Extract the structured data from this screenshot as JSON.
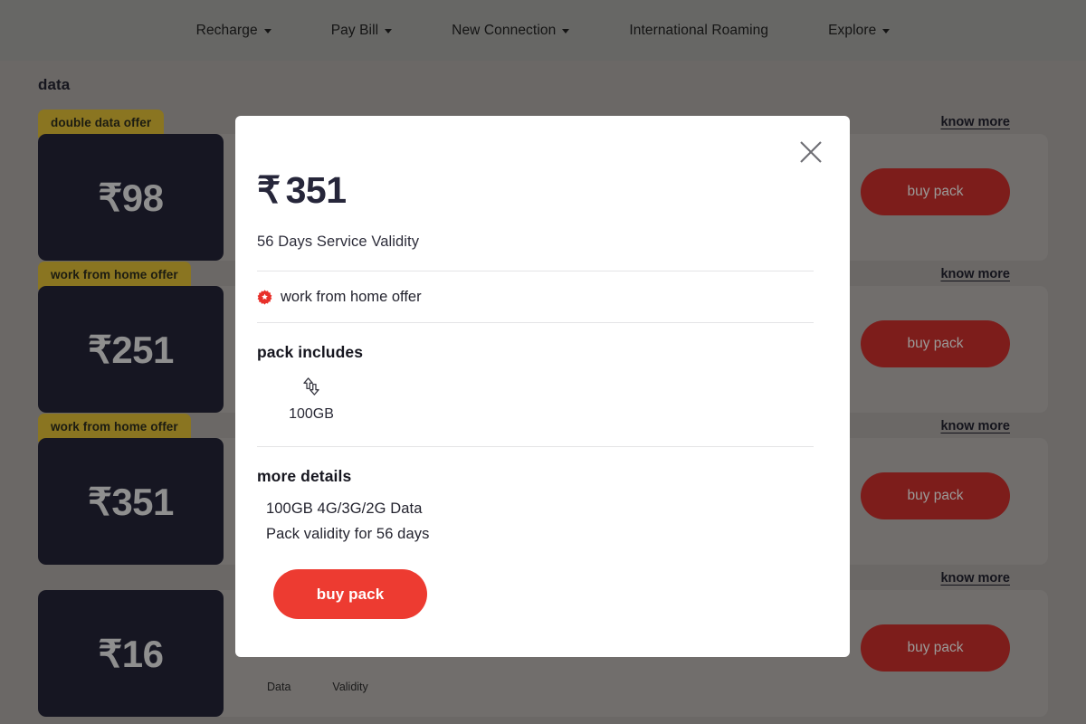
{
  "nav": {
    "items": [
      {
        "label": "Recharge",
        "has_caret": true,
        "icon": "chevron-down-icon"
      },
      {
        "label": "Pay Bill",
        "has_caret": true,
        "icon": "chevron-down-icon"
      },
      {
        "label": "New Connection",
        "has_caret": true,
        "icon": "chevron-down-icon"
      },
      {
        "label": "International Roaming",
        "has_caret": false,
        "icon": ""
      },
      {
        "label": "Explore",
        "has_caret": true,
        "icon": "chevron-down-icon"
      }
    ]
  },
  "page": {
    "section_title": "data",
    "meta_columns": {
      "data_label": "Data",
      "validity_label": "Validity"
    },
    "know_more_label": "know more",
    "buy_pack_label": "buy pack",
    "packs": [
      {
        "price": "₹98",
        "offer": "double data offer"
      },
      {
        "price": "₹251",
        "offer": "work from home offer"
      },
      {
        "price": "₹351",
        "offer": "work from home offer"
      },
      {
        "price": "₹16",
        "offer": ""
      }
    ]
  },
  "modal": {
    "close_icon": "close-icon",
    "currency": "₹",
    "price": "351",
    "validity": "56 Days Service Validity",
    "offer": {
      "icon": "offer-badge-icon",
      "label": "work from home offer"
    },
    "pack_includes": {
      "title": "pack includes",
      "items": [
        {
          "icon": "data-transfer-icon",
          "label": "100GB"
        }
      ]
    },
    "more_details": {
      "title": "more details",
      "lines": [
        "100GB 4G/3G/2G Data",
        "Pack validity for 56 days"
      ]
    },
    "buy_button": "buy pack"
  },
  "colors": {
    "accent_red": "#ED3B31",
    "dim_red": "#7D1D1B",
    "offer_gold": "#8A7521",
    "tile_dark": "#161622",
    "page_dim": "#6B6866",
    "nav_dim": "#676765",
    "price_navy": "#26263A"
  }
}
